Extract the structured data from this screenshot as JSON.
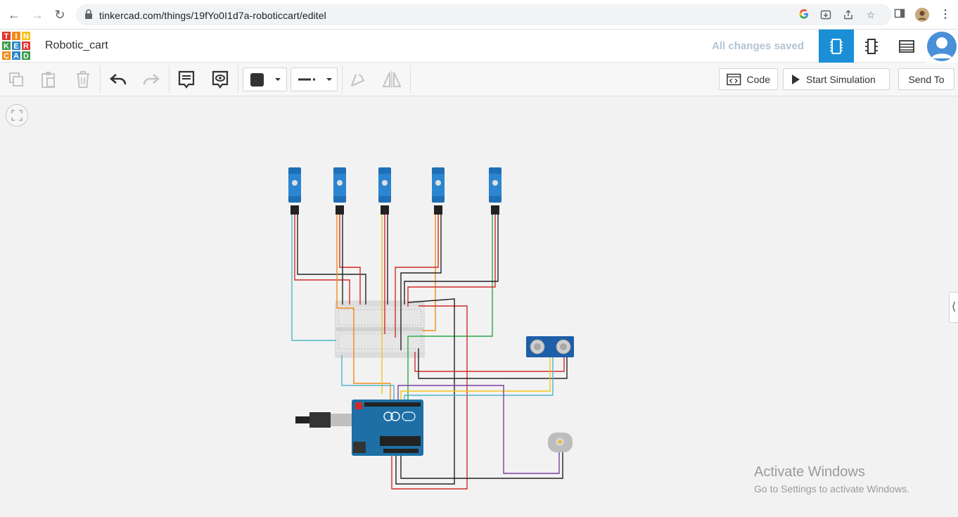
{
  "browser": {
    "url": "tinkercad.com/things/19fYo0I1d7a-roboticcart/editel"
  },
  "header": {
    "logo_letters": [
      "T",
      "I",
      "N",
      "K",
      "E",
      "R",
      "C",
      "A",
      "D"
    ],
    "logo_colors": [
      "#e2352b",
      "#f08c1b",
      "#f7c21a",
      "#3a9a49",
      "#2a87c8",
      "#e2352b",
      "#f08c1b",
      "#2a87c8",
      "#3a9a49"
    ],
    "project_name": "Robotic_cart",
    "save_status": "All changes saved",
    "accent": "#1a8fd6"
  },
  "toolbar": {
    "code_label": "Code",
    "simulate_label": "Start Simulation",
    "send_to_label": "Send To"
  },
  "canvas": {
    "components": [
      "servo-1",
      "servo-2",
      "servo-3",
      "servo-4",
      "servo-5",
      "breadboard",
      "ultrasonic-sensor",
      "arduino-uno",
      "dc-motor"
    ]
  },
  "watermark": {
    "title": "Activate Windows",
    "subtitle": "Go to Settings to activate Windows."
  }
}
